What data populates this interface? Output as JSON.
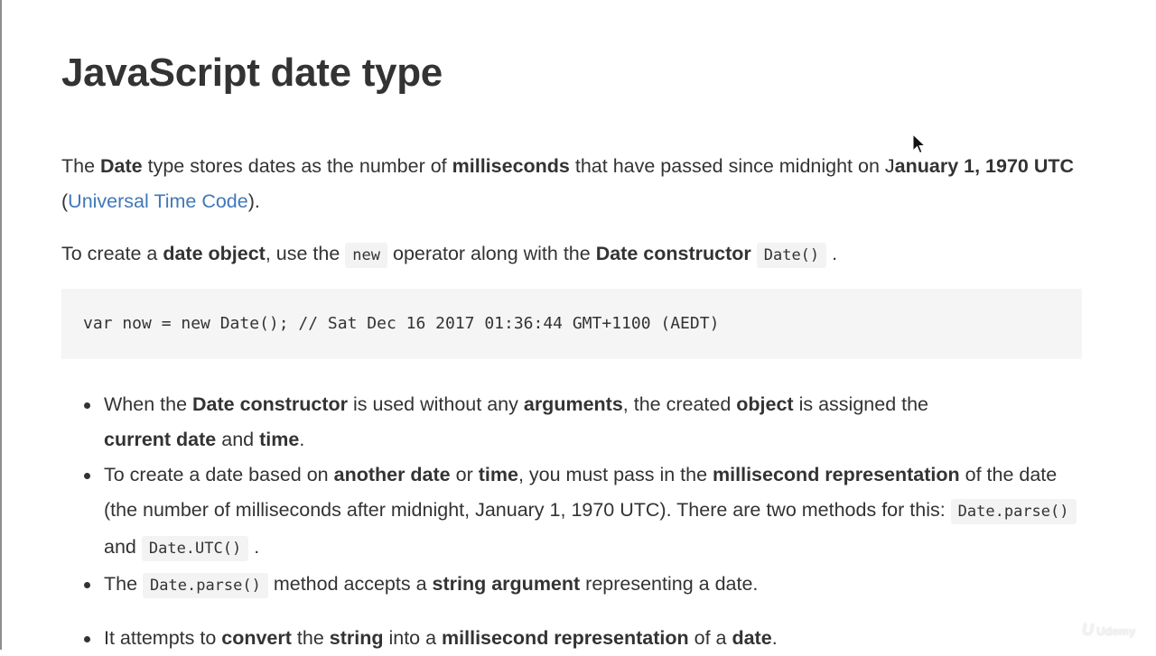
{
  "page": {
    "title": "JavaScript date type"
  },
  "intro": {
    "p1": {
      "t1": "The ",
      "b1": "Date",
      "t2": " type stores dates as the number of ",
      "b2": "milliseconds",
      "t3": " that have passed since midnight on J",
      "b3": "anuary 1, 1970 UTC",
      "t4": " (",
      "link": "Universal Time Code",
      "t5": ")."
    },
    "p2": {
      "t1": "To create a ",
      "b1": "date object",
      "t2": ", use the ",
      "code1": "new",
      "t3": " operator along with the ",
      "b2": "Date constructor",
      "code2": "Date()",
      "t4": " ."
    }
  },
  "code_block": {
    "code": "var now = new Date(); // Sat Dec 16 2017 01:36:44 GMT+1100 (AEDT)"
  },
  "bullets": [
    {
      "t1": "When the ",
      "b1": "Date constructor",
      "t2": " is used without any ",
      "b2": "arguments",
      "t3": ", the created ",
      "b3": "object",
      "t4": " is assigned the ",
      "b4": "current date",
      "t5": " and ",
      "b5": "time",
      "t6": "."
    },
    {
      "t1": "To create a date based on ",
      "b1": "another date",
      "t2": " or ",
      "b2": "time",
      "t3": ", you must pass in the ",
      "b3": "millisecond representation",
      "t4": " of the date (the number of milliseconds after midnight, January 1, 1970 UTC). There are two methods for this: ",
      "code1": "Date.parse()",
      "t5": " and ",
      "code2": "Date.UTC()",
      "t6": " ."
    },
    {
      "t1": "The ",
      "code1": "Date.parse()",
      "t2": " method accepts a ",
      "b1": "string argument",
      "t3": " representing a date."
    },
    {
      "t1": "It attempts to ",
      "b1": "convert",
      "t2": " the ",
      "b2": "string",
      "t3": " into a ",
      "b3": "millisecond representation",
      "t4": " of a ",
      "b4": "date",
      "t5": "."
    }
  ],
  "watermark": {
    "logo": "U",
    "text": "Udemy"
  },
  "colors": {
    "link": "#4078b8",
    "text": "#333333",
    "code_bg": "#f5f5f5"
  },
  "icons": {
    "cursor": "mouse-pointer-icon"
  }
}
